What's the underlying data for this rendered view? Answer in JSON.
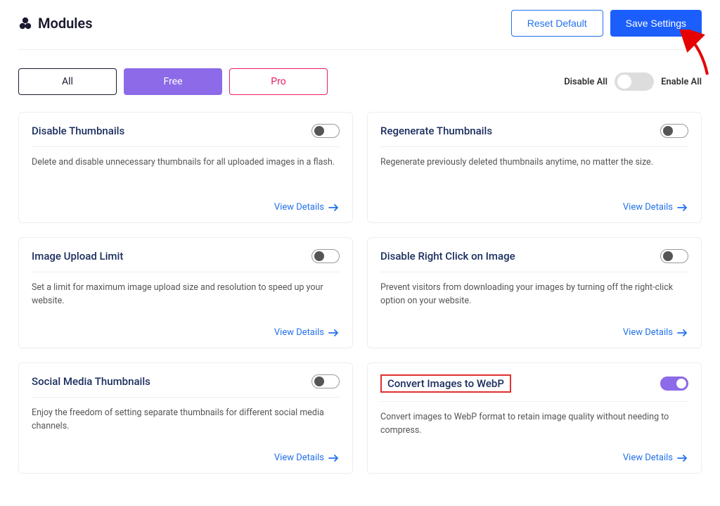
{
  "header": {
    "title": "Modules",
    "reset_label": "Reset Default",
    "save_label": "Save Settings"
  },
  "filter": {
    "tabs": {
      "all": "All",
      "free": "Free",
      "pro": "Pro"
    },
    "disable_all": "Disable All",
    "enable_all": "Enable All"
  },
  "view_details": "View Details",
  "modules": [
    {
      "title": "Disable Thumbnails",
      "desc": "Delete and disable unnecessary thumbnails for all uploaded images in a flash.",
      "on": false,
      "highlight": false
    },
    {
      "title": "Regenerate Thumbnails",
      "desc": "Regenerate previously deleted thumbnails anytime, no matter the size.",
      "on": false,
      "highlight": false
    },
    {
      "title": "Image Upload Limit",
      "desc": "Set a limit for maximum image upload size and resolution to speed up your website.",
      "on": false,
      "highlight": false
    },
    {
      "title": "Disable Right Click on Image",
      "desc": "Prevent visitors from downloading your images by turning off the right-click option on your website.",
      "on": false,
      "highlight": false
    },
    {
      "title": "Social Media Thumbnails",
      "desc": "Enjoy the freedom of setting separate thumbnails for different social media channels.",
      "on": false,
      "highlight": false
    },
    {
      "title": "Convert Images to WebP",
      "desc": "Convert images to WebP format to retain image quality without needing to compress.",
      "on": true,
      "highlight": true
    }
  ]
}
